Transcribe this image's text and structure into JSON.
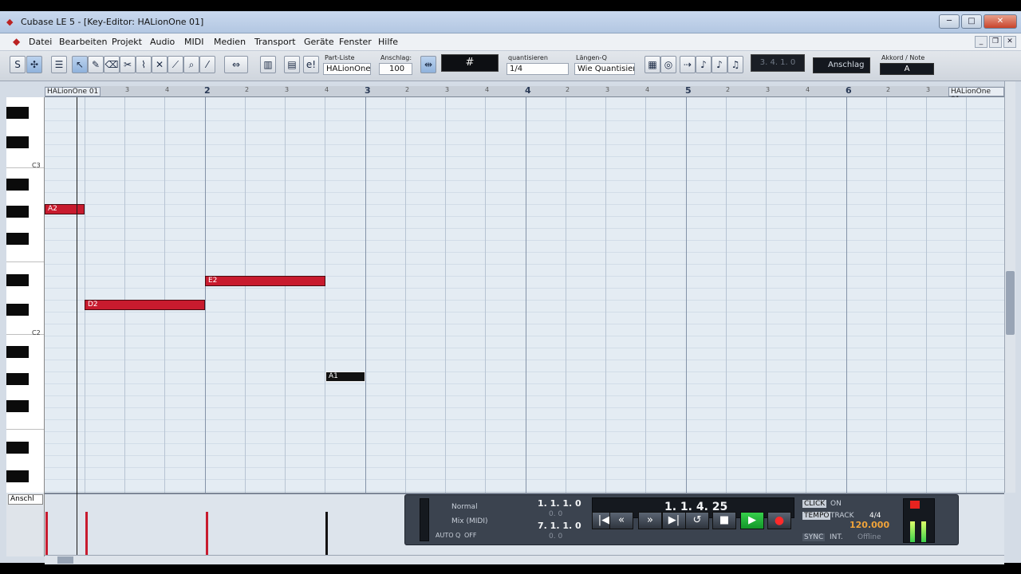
{
  "window": {
    "title": "Cubase LE 5 - [Key-Editor: HALionOne 01]",
    "minimize": "─",
    "maximize": "□",
    "close": "✕"
  },
  "menu": [
    "Datei",
    "Bearbeiten",
    "Projekt",
    "Audio",
    "MIDI",
    "Medien",
    "Transport",
    "Geräte",
    "Fenster",
    "Hilfe"
  ],
  "toolbar": {
    "partliste_label": "Part-Liste",
    "partliste_value": "HALionOne",
    "anschlag_label": "Anschlag:",
    "anschlag_value": "100",
    "quantize_label": "quantisieren",
    "quantize_value": "1/4",
    "length_label": "Längen-Q",
    "length_value": "Wie Quantisiert",
    "position": "3. 4. 1.   0",
    "velocity_mode": "Anschlag",
    "chord_label": "Akkord / Note",
    "chord_value": "A"
  },
  "ruler": {
    "part_label_left": "HALionOne 01",
    "part_label_right": "HALionOne 01",
    "bars": [
      "2",
      "3",
      "4",
      "5",
      "6"
    ],
    "beats": [
      "3",
      "4",
      "2",
      "3",
      "4",
      "2",
      "3",
      "4",
      "2",
      "3",
      "4",
      "2",
      "3",
      "4",
      "2",
      "3"
    ]
  },
  "keyboard": {
    "c3": "C3",
    "c2": "C2"
  },
  "notes": [
    {
      "label": "A2",
      "color": "#c81b2e"
    },
    {
      "label": "E2",
      "color": "#c81b2e"
    },
    {
      "label": "D2",
      "color": "#c81b2e"
    },
    {
      "label": "A1",
      "color": "#121212"
    }
  ],
  "velocity": {
    "selector": "Anschl"
  },
  "transport": {
    "mode1": "Normal",
    "mode2": "Mix (MIDI)",
    "auto_q": "AUTO Q",
    "auto_q_state": "OFF",
    "left_locator": "1.  1.  1.    0",
    "left_sub": "0.   0",
    "right_locator": "7.  1.  1.    0",
    "right_sub": "0.   0",
    "position": "1.  1.  4.  25",
    "click": "CLICK",
    "click_state": "ON",
    "tempo": "TEMPO",
    "tempo_mode": "TRACK",
    "signature": "4/4",
    "tempo_value": "120.000",
    "sync": "SYNC",
    "sync_source": "INT.",
    "sync_state": "Offline"
  }
}
